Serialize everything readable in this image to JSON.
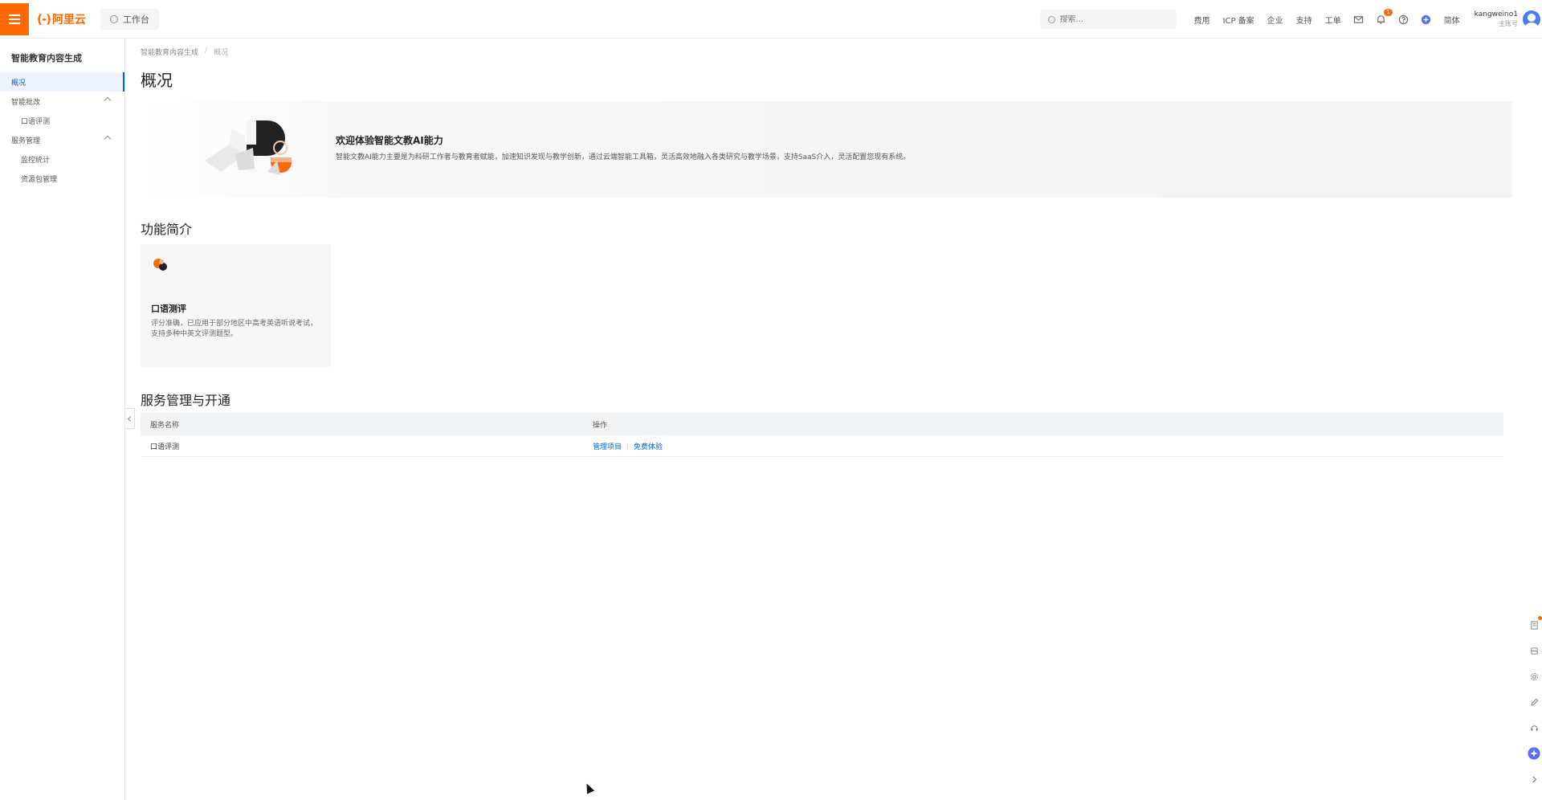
{
  "header": {
    "logo_mark": "(-)",
    "logo_text": "阿里云",
    "workbench_label": "工作台",
    "search_placeholder": "搜索...",
    "nav_links": [
      "费用",
      "ICP 备案",
      "企业",
      "支持",
      "工单"
    ],
    "notification_count": "1",
    "language_label": "简体",
    "user_name": "kangweino1",
    "user_sub": "主账号"
  },
  "sidebar": {
    "title": "智能教育内容生成",
    "items": [
      {
        "label": "概况",
        "active": true,
        "level": 0
      },
      {
        "label": "智能批改",
        "level": 0,
        "expanded": true
      },
      {
        "label": "口语评测",
        "level": 1
      },
      {
        "label": "服务管理",
        "level": 0,
        "expanded": true
      },
      {
        "label": "监控统计",
        "level": 1
      },
      {
        "label": "资源包管理",
        "level": 1
      }
    ]
  },
  "main": {
    "breadcrumb": [
      "智能教育内容生成",
      "概况"
    ],
    "title": "概况",
    "welcome": {
      "title": "欢迎体验智能文教AI能力",
      "desc": "智能文教AI能力主要是为科研工作者与教育者赋能，加速知识发现与教学创新，通过云端智能工具箱，灵活高效地融入各类研究与教学场景，支持SaaS介入，灵活配置您现有系统。"
    },
    "features_title": "功能简介",
    "feature_card": {
      "title": "口语测评",
      "desc": "评分准确，已应用于部分地区中高考英语听说考试，支持多种中英文评测题型。"
    },
    "services_title": "服务管理与开通",
    "table": {
      "headers": [
        "服务名称",
        "操作"
      ],
      "rows": [
        {
          "name": "口语评测",
          "actions": [
            "管理项目",
            "免费体验"
          ]
        }
      ]
    }
  },
  "colors": {
    "brand": "#ff6a00",
    "link": "#0064c8"
  }
}
